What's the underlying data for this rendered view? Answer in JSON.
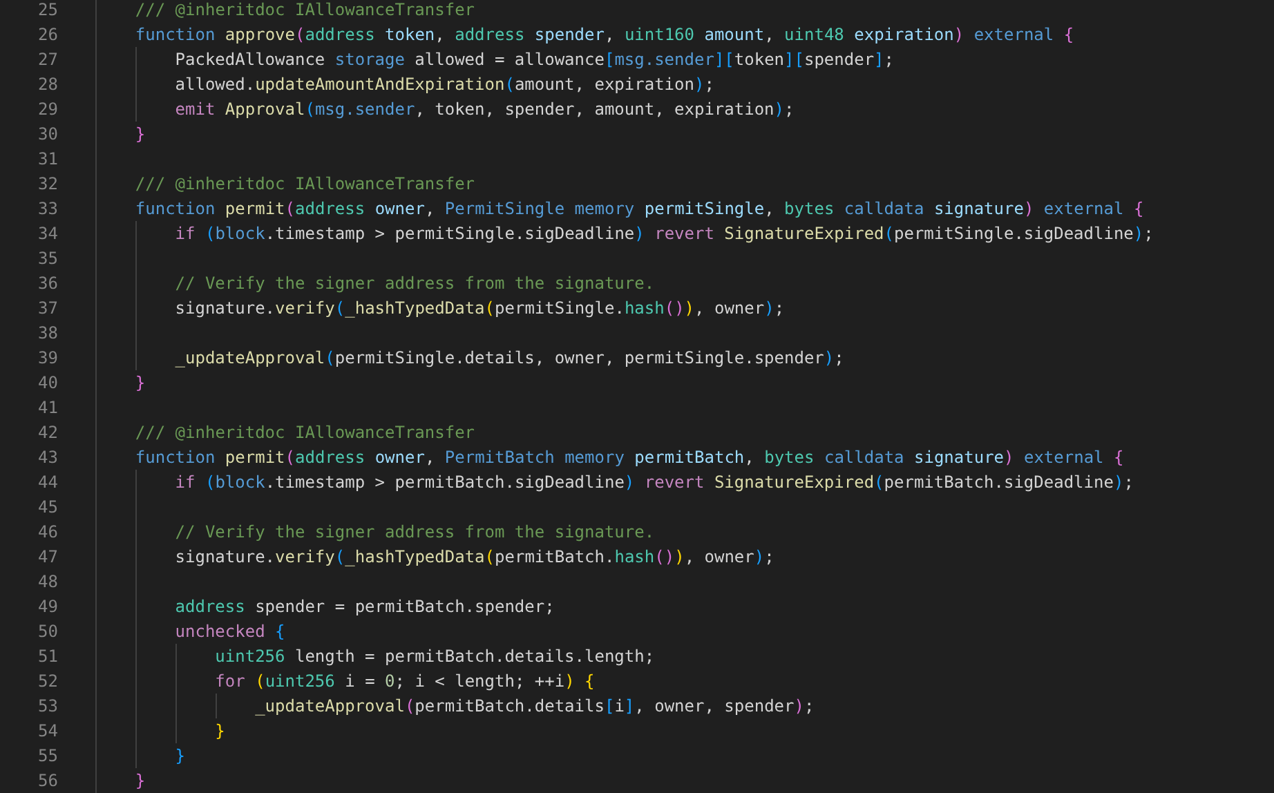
{
  "editor": {
    "lines": [
      {
        "number": "25",
        "tokens": [
          {
            "text": "    /// @inheritdoc IAllowanceTransfer",
            "kind": "comment"
          }
        ]
      },
      {
        "number": "26",
        "tokens": [
          {
            "text": "    function ",
            "kind": "keyword"
          },
          {
            "text": "approve",
            "kind": "function"
          },
          {
            "text": "(",
            "kind": "bracket2"
          },
          {
            "text": "address ",
            "kind": "type"
          },
          {
            "text": "token",
            "kind": "variable"
          },
          {
            "text": ", ",
            "kind": "plain"
          },
          {
            "text": "address ",
            "kind": "type"
          },
          {
            "text": "spender",
            "kind": "variable"
          },
          {
            "text": ", ",
            "kind": "plain"
          },
          {
            "text": "uint160 ",
            "kind": "type"
          },
          {
            "text": "amount",
            "kind": "variable"
          },
          {
            "text": ", ",
            "kind": "plain"
          },
          {
            "text": "uint48 ",
            "kind": "type"
          },
          {
            "text": "expiration",
            "kind": "variable"
          },
          {
            "text": ") ",
            "kind": "bracket2"
          },
          {
            "text": "external ",
            "kind": "keyword"
          },
          {
            "text": "{",
            "kind": "bracket2"
          }
        ]
      },
      {
        "number": "27",
        "tokens": [
          {
            "text": "        PackedAllowance ",
            "kind": "plain"
          },
          {
            "text": "storage",
            "kind": "keyword"
          },
          {
            "text": " allowed = allowance",
            "kind": "plain"
          },
          {
            "text": "[",
            "kind": "bracket3"
          },
          {
            "text": "msg.sender",
            "kind": "keyword"
          },
          {
            "text": "][",
            "kind": "bracket3"
          },
          {
            "text": "token",
            "kind": "plain"
          },
          {
            "text": "][",
            "kind": "bracket3"
          },
          {
            "text": "spender",
            "kind": "plain"
          },
          {
            "text": "]",
            "kind": "bracket3"
          },
          {
            "text": ";",
            "kind": "plain"
          }
        ]
      },
      {
        "number": "28",
        "tokens": [
          {
            "text": "        allowed.",
            "kind": "plain"
          },
          {
            "text": "updateAmountAndExpiration",
            "kind": "function"
          },
          {
            "text": "(",
            "kind": "bracket3"
          },
          {
            "text": "amount, expiration",
            "kind": "plain"
          },
          {
            "text": ")",
            "kind": "bracket3"
          },
          {
            "text": ";",
            "kind": "plain"
          }
        ]
      },
      {
        "number": "29",
        "tokens": [
          {
            "text": "        emit ",
            "kind": "control"
          },
          {
            "text": "Approval",
            "kind": "function"
          },
          {
            "text": "(",
            "kind": "bracket3"
          },
          {
            "text": "msg.sender",
            "kind": "keyword"
          },
          {
            "text": ", token, spender, amount, expiration",
            "kind": "plain"
          },
          {
            "text": ")",
            "kind": "bracket3"
          },
          {
            "text": ";",
            "kind": "plain"
          }
        ]
      },
      {
        "number": "30",
        "tokens": [
          {
            "text": "    }",
            "kind": "bracket2"
          }
        ]
      },
      {
        "number": "31"
      },
      {
        "number": "32",
        "tokens": [
          {
            "text": "    /// @inheritdoc IAllowanceTransfer",
            "kind": "comment"
          }
        ]
      },
      {
        "number": "33",
        "tokens": [
          {
            "text": "    function ",
            "kind": "keyword"
          },
          {
            "text": "permit",
            "kind": "function"
          },
          {
            "text": "(",
            "kind": "bracket2"
          },
          {
            "text": "address ",
            "kind": "type"
          },
          {
            "text": "owner",
            "kind": "variable"
          },
          {
            "text": ", ",
            "kind": "plain"
          },
          {
            "text": "PermitSingle memory ",
            "kind": "keyword"
          },
          {
            "text": "permitSingle",
            "kind": "variable"
          },
          {
            "text": ", ",
            "kind": "plain"
          },
          {
            "text": "bytes ",
            "kind": "type"
          },
          {
            "text": "calldata ",
            "kind": "keyword"
          },
          {
            "text": "signature",
            "kind": "variable"
          },
          {
            "text": ") ",
            "kind": "bracket2"
          },
          {
            "text": "external ",
            "kind": "keyword"
          },
          {
            "text": "{",
            "kind": "bracket2"
          }
        ]
      },
      {
        "number": "34",
        "tokens": [
          {
            "text": "        if ",
            "kind": "control"
          },
          {
            "text": "(",
            "kind": "bracket3"
          },
          {
            "text": "block",
            "kind": "keyword"
          },
          {
            "text": ".timestamp > permitSingle.sigDeadline",
            "kind": "plain"
          },
          {
            "text": ") ",
            "kind": "bracket3"
          },
          {
            "text": "revert ",
            "kind": "control"
          },
          {
            "text": "SignatureExpired",
            "kind": "function"
          },
          {
            "text": "(",
            "kind": "bracket3"
          },
          {
            "text": "permitSingle.sigDeadline",
            "kind": "plain"
          },
          {
            "text": ")",
            "kind": "bracket3"
          },
          {
            "text": ";",
            "kind": "plain"
          }
        ]
      },
      {
        "number": "35"
      },
      {
        "number": "36",
        "tokens": [
          {
            "text": "        // Verify the signer address from the signature.",
            "kind": "comment"
          }
        ]
      },
      {
        "number": "37",
        "tokens": [
          {
            "text": "        signature.",
            "kind": "plain"
          },
          {
            "text": "verify",
            "kind": "function"
          },
          {
            "text": "(",
            "kind": "bracket3"
          },
          {
            "text": "_hashTypedData",
            "kind": "function"
          },
          {
            "text": "(",
            "kind": "bracket1"
          },
          {
            "text": "permitSingle.",
            "kind": "plain"
          },
          {
            "text": "hash",
            "kind": "type"
          },
          {
            "text": "()",
            "kind": "bracket2"
          },
          {
            "text": ")",
            "kind": "bracket1"
          },
          {
            "text": ", owner",
            "kind": "plain"
          },
          {
            "text": ")",
            "kind": "bracket3"
          },
          {
            "text": ";",
            "kind": "plain"
          }
        ]
      },
      {
        "number": "38"
      },
      {
        "number": "39",
        "tokens": [
          {
            "text": "        _updateApproval",
            "kind": "function"
          },
          {
            "text": "(",
            "kind": "bracket3"
          },
          {
            "text": "permitSingle.details, owner, permitSingle.spender",
            "kind": "plain"
          },
          {
            "text": ")",
            "kind": "bracket3"
          },
          {
            "text": ";",
            "kind": "plain"
          }
        ]
      },
      {
        "number": "40",
        "tokens": [
          {
            "text": "    }",
            "kind": "bracket2"
          }
        ]
      },
      {
        "number": "41"
      },
      {
        "number": "42",
        "tokens": [
          {
            "text": "    /// @inheritdoc IAllowanceTransfer",
            "kind": "comment"
          }
        ]
      },
      {
        "number": "43",
        "tokens": [
          {
            "text": "    function ",
            "kind": "keyword"
          },
          {
            "text": "permit",
            "kind": "function"
          },
          {
            "text": "(",
            "kind": "bracket2"
          },
          {
            "text": "address ",
            "kind": "type"
          },
          {
            "text": "owner",
            "kind": "variable"
          },
          {
            "text": ", ",
            "kind": "plain"
          },
          {
            "text": "PermitBatch memory ",
            "kind": "keyword"
          },
          {
            "text": "permitBatch",
            "kind": "variable"
          },
          {
            "text": ", ",
            "kind": "plain"
          },
          {
            "text": "bytes ",
            "kind": "type"
          },
          {
            "text": "calldata ",
            "kind": "keyword"
          },
          {
            "text": "signature",
            "kind": "variable"
          },
          {
            "text": ") ",
            "kind": "bracket2"
          },
          {
            "text": "external ",
            "kind": "keyword"
          },
          {
            "text": "{",
            "kind": "bracket2"
          }
        ]
      },
      {
        "number": "44",
        "tokens": [
          {
            "text": "        if ",
            "kind": "control"
          },
          {
            "text": "(",
            "kind": "bracket3"
          },
          {
            "text": "block",
            "kind": "keyword"
          },
          {
            "text": ".timestamp > permitBatch.sigDeadline",
            "kind": "plain"
          },
          {
            "text": ") ",
            "kind": "bracket3"
          },
          {
            "text": "revert ",
            "kind": "control"
          },
          {
            "text": "SignatureExpired",
            "kind": "function"
          },
          {
            "text": "(",
            "kind": "bracket3"
          },
          {
            "text": "permitBatch.sigDeadline",
            "kind": "plain"
          },
          {
            "text": ")",
            "kind": "bracket3"
          },
          {
            "text": ";",
            "kind": "plain"
          }
        ]
      },
      {
        "number": "45"
      },
      {
        "number": "46",
        "tokens": [
          {
            "text": "        // Verify the signer address from the signature.",
            "kind": "comment"
          }
        ]
      },
      {
        "number": "47",
        "tokens": [
          {
            "text": "        signature.",
            "kind": "plain"
          },
          {
            "text": "verify",
            "kind": "function"
          },
          {
            "text": "(",
            "kind": "bracket3"
          },
          {
            "text": "_hashTypedData",
            "kind": "function"
          },
          {
            "text": "(",
            "kind": "bracket1"
          },
          {
            "text": "permitBatch.",
            "kind": "plain"
          },
          {
            "text": "hash",
            "kind": "type"
          },
          {
            "text": "()",
            "kind": "bracket2"
          },
          {
            "text": ")",
            "kind": "bracket1"
          },
          {
            "text": ", owner",
            "kind": "plain"
          },
          {
            "text": ")",
            "kind": "bracket3"
          },
          {
            "text": ";",
            "kind": "plain"
          }
        ]
      },
      {
        "number": "48"
      },
      {
        "number": "49",
        "tokens": [
          {
            "text": "        address",
            "kind": "type"
          },
          {
            "text": " spender = permitBatch.spender;",
            "kind": "plain"
          }
        ]
      },
      {
        "number": "50",
        "tokens": [
          {
            "text": "        unchecked ",
            "kind": "control"
          },
          {
            "text": "{",
            "kind": "bracket3"
          }
        ]
      },
      {
        "number": "51",
        "tokens": [
          {
            "text": "            uint256",
            "kind": "type"
          },
          {
            "text": " length = permitBatch.details.length;",
            "kind": "plain"
          }
        ]
      },
      {
        "number": "52",
        "tokens": [
          {
            "text": "            for ",
            "kind": "control"
          },
          {
            "text": "(",
            "kind": "bracket1"
          },
          {
            "text": "uint256",
            "kind": "type"
          },
          {
            "text": " i = ",
            "kind": "plain"
          },
          {
            "text": "0",
            "kind": "number"
          },
          {
            "text": "; i < length; ++i",
            "kind": "plain"
          },
          {
            "text": ") {",
            "kind": "bracket1"
          }
        ]
      },
      {
        "number": "53",
        "tokens": [
          {
            "text": "                _updateApproval",
            "kind": "function"
          },
          {
            "text": "(",
            "kind": "bracket2"
          },
          {
            "text": "permitBatch.details",
            "kind": "plain"
          },
          {
            "text": "[",
            "kind": "bracket3"
          },
          {
            "text": "i",
            "kind": "plain"
          },
          {
            "text": "]",
            "kind": "bracket3"
          },
          {
            "text": ", owner, spender",
            "kind": "plain"
          },
          {
            "text": ")",
            "kind": "bracket2"
          },
          {
            "text": ";",
            "kind": "plain"
          }
        ]
      },
      {
        "number": "54",
        "tokens": [
          {
            "text": "            }",
            "kind": "bracket1"
          }
        ]
      },
      {
        "number": "55",
        "tokens": [
          {
            "text": "        }",
            "kind": "bracket3"
          }
        ]
      },
      {
        "number": "56",
        "tokens": [
          {
            "text": "    }",
            "kind": "bracket2"
          }
        ]
      }
    ]
  }
}
